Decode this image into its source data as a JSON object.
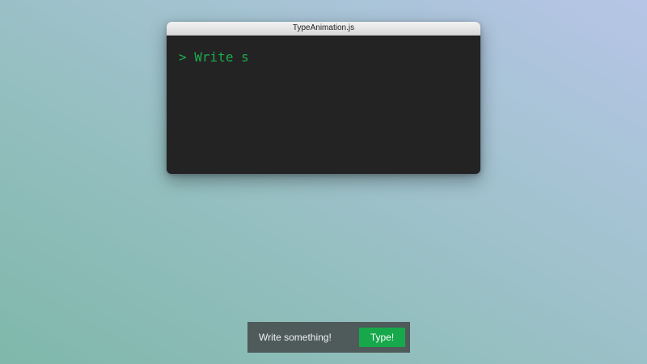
{
  "window": {
    "title": "TypeAnimation.js"
  },
  "terminal": {
    "prompt": ">",
    "typed_text": "Write s",
    "text_color": "#1dab4e",
    "background_color": "#232323"
  },
  "controls": {
    "input_value": "Write something!",
    "button_label": "Type!",
    "button_color": "#16a84a"
  }
}
